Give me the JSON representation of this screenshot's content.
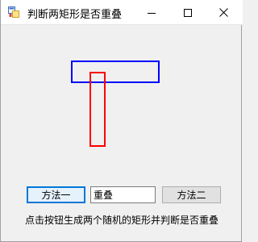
{
  "window": {
    "title": "判断两矩形是否重叠",
    "icon": "winforms-app-icon",
    "controls": {
      "minimize_icon": "minimize-icon",
      "maximize_icon": "maximize-icon",
      "close_icon": "close-icon"
    }
  },
  "canvas": {
    "rect_a": {
      "color": "#0000ff"
    },
    "rect_b": {
      "color": "#ff0000"
    }
  },
  "controls": {
    "method1_label": "方法一",
    "result_value": "重叠",
    "method2_label": "方法二"
  },
  "hint": "点击按钮生成两个随机的矩形并判断是否重叠",
  "colors": {
    "window_bg": "#f0f0f0",
    "titlebar_bg": "#ffffff",
    "focus_border": "#0078d7"
  }
}
